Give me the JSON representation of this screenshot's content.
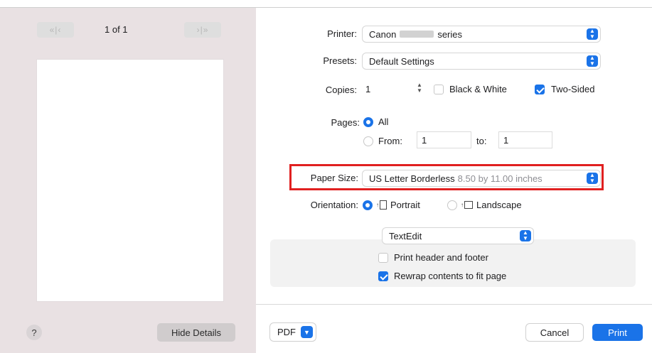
{
  "preview": {
    "first_label": "«|‹",
    "next_label": "›|»",
    "page_count": "1 of 1",
    "help_label": "?",
    "hide_details_label": "Hide Details"
  },
  "printer": {
    "label": "Printer:",
    "brand": "Canon",
    "model_suffix": "series"
  },
  "presets": {
    "label": "Presets:",
    "value": "Default Settings"
  },
  "copies": {
    "label": "Copies:",
    "value": "1",
    "black_white_label": "Black & White",
    "black_white_checked": false,
    "two_sided_label": "Two-Sided",
    "two_sided_checked": true
  },
  "pages": {
    "label": "Pages:",
    "all_label": "All",
    "all_selected": true,
    "from_label": "From:",
    "from_value": "1",
    "to_label": "to:",
    "to_value": "1"
  },
  "paper_size": {
    "label": "Paper Size:",
    "value": "US Letter Borderless",
    "dimensions": "8.50 by 11.00 inches"
  },
  "orientation": {
    "label": "Orientation:",
    "portrait_label": "Portrait",
    "landscape_label": "Landscape",
    "selected": "Portrait"
  },
  "app_section": {
    "dropdown_value": "TextEdit",
    "header_footer_label": "Print header and footer",
    "header_footer_checked": false,
    "rewrap_label": "Rewrap contents to fit page",
    "rewrap_checked": true
  },
  "footer": {
    "pdf_label": "PDF",
    "cancel_label": "Cancel",
    "print_label": "Print"
  },
  "colors": {
    "accent": "#1a73e8",
    "highlight_border": "#e02020",
    "sidebar_bg": "#e9e1e3"
  }
}
